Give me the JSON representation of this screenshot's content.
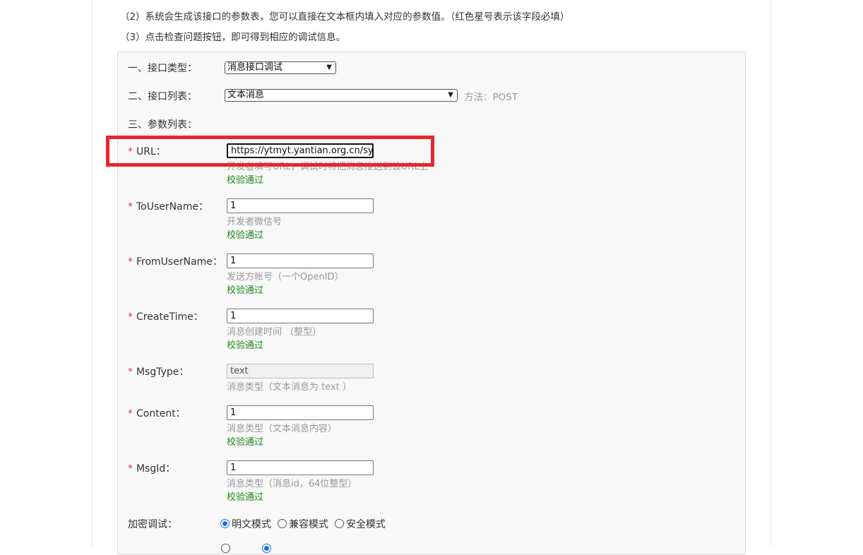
{
  "instructions": {
    "line2": "（2）系统会生成该接口的参数表，您可以直接在文本框内填入对应的参数值。（红色星号表示该字段必填）",
    "line3": "（3）点击检查问题按钮，即可得到相应的调试信息。"
  },
  "interface_type": {
    "label": "一、接口类型：",
    "value": "消息接口调试"
  },
  "interface_list": {
    "label": "二、接口列表：",
    "value": "文本消息",
    "method": "方法：POST"
  },
  "param_list": {
    "label": "三、参数列表："
  },
  "required_mark": "*",
  "fields": {
    "url": {
      "label": "URL：",
      "value": "https://ytmyt.yantian.org.cn/sysatta",
      "hint": "开发者填写URL，调试时将把消息推送到该URL上",
      "status": "校验通过"
    },
    "to_user": {
      "label": "ToUserName：",
      "value": "1",
      "hint": "开发者微信号",
      "status": "校验通过"
    },
    "from_user": {
      "label": "FromUserName：",
      "value": "1",
      "hint": "发送方帐号（一个OpenID）",
      "status": "校验通过"
    },
    "create_time": {
      "label": "CreateTime：",
      "value": "1",
      "hint": "消息创建时间 （整型）",
      "status": "校验通过"
    },
    "msg_type": {
      "label": "MsgType：",
      "value": "text",
      "hint": "消息类型（文本消息为 text ）"
    },
    "content": {
      "label": "Content：",
      "value": "1",
      "hint": "消息类型（文本消息内容）",
      "status": "校验通过"
    },
    "msg_id": {
      "label": "MsgId：",
      "value": "1",
      "hint": "消息类型（消息id，64位整型）",
      "status": "校验通过"
    }
  },
  "encryption": {
    "label": "加密调试：",
    "options": [
      "明文模式",
      "兼容模式",
      "安全模式"
    ],
    "selected": "明文模式"
  },
  "colors": {
    "required": "#e53935",
    "valid": "#1b8a1b",
    "highlight": "#e8262c",
    "radio": "#1a73e8"
  },
  "icons": {
    "caret": "chevron-down-icon"
  }
}
